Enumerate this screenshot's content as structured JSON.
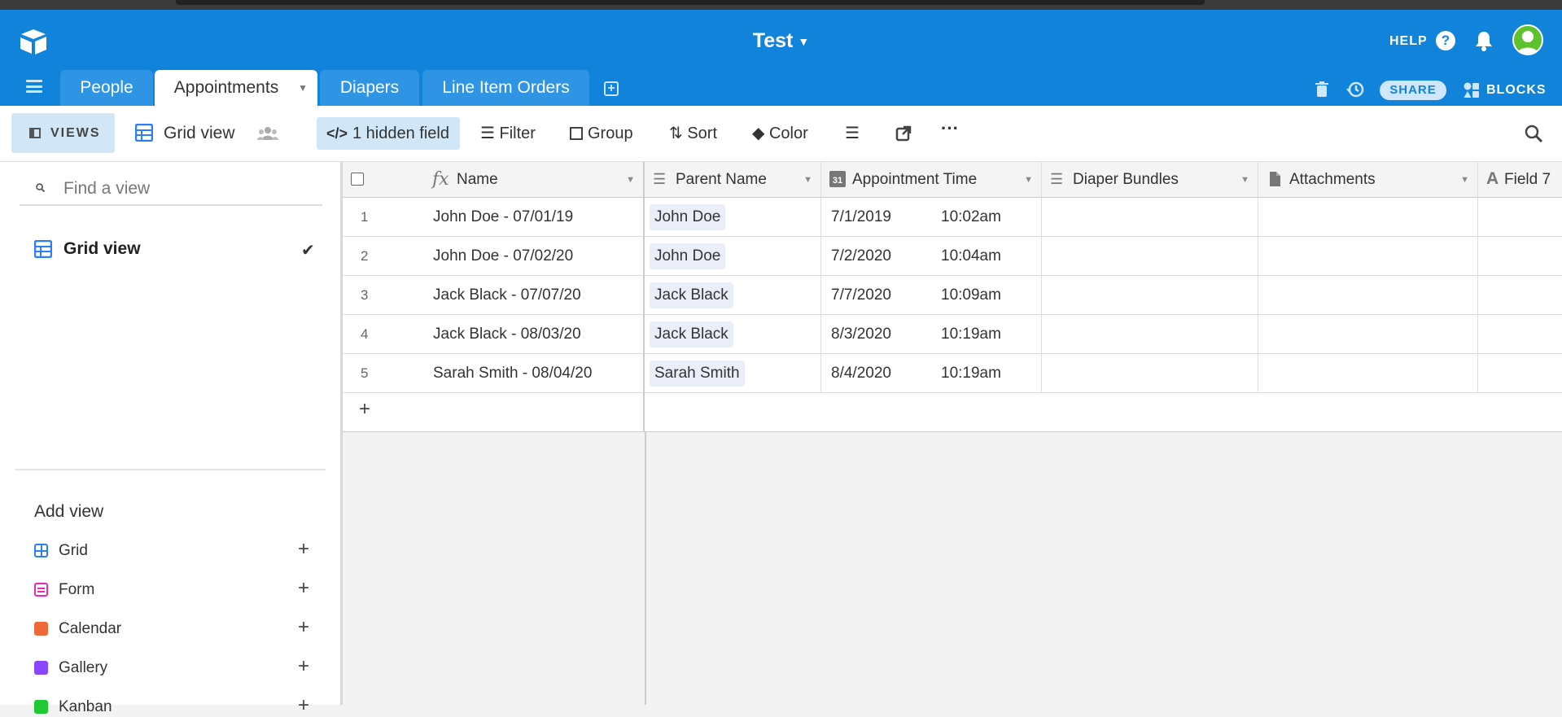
{
  "header": {
    "base_name": "Test",
    "help_label": "HELP",
    "share_label": "SHARE",
    "blocks_label": "BLOCKS"
  },
  "tabs": [
    {
      "label": "People"
    },
    {
      "label": "Appointments"
    },
    {
      "label": "Diapers"
    },
    {
      "label": "Line Item Orders"
    }
  ],
  "toolbar": {
    "views_label": "VIEWS",
    "current_view": "Grid view",
    "hidden_fields": "1 hidden field",
    "filter": "Filter",
    "group": "Group",
    "sort": "Sort",
    "color": "Color"
  },
  "sidebar": {
    "search_placeholder": "Find a view",
    "views": [
      {
        "label": "Grid view",
        "selected": true
      }
    ],
    "add_view_label": "Add view",
    "view_types": [
      {
        "label": "Grid",
        "color": "#2d7ff9"
      },
      {
        "label": "Form",
        "color": "#e929ba"
      },
      {
        "label": "Calendar",
        "color": "#f0693b"
      },
      {
        "label": "Gallery",
        "color": "#8b46ff"
      },
      {
        "label": "Kanban",
        "color": "#20c933"
      }
    ]
  },
  "grid": {
    "columns": [
      "Name",
      "Parent Name",
      "Appointment Time",
      "Diaper Bundles",
      "Attachments",
      "Field 7"
    ],
    "rows": [
      {
        "num": "1",
        "name": "John Doe - 07/01/19",
        "parent": "John Doe",
        "date": "7/1/2019",
        "time": "10:02am"
      },
      {
        "num": "2",
        "name": "John Doe - 07/02/20",
        "parent": "John Doe",
        "date": "7/2/2020",
        "time": "10:04am"
      },
      {
        "num": "3",
        "name": "Jack Black - 07/07/20",
        "parent": "Jack Black",
        "date": "7/7/2020",
        "time": "10:09am"
      },
      {
        "num": "4",
        "name": "Jack Black - 08/03/20",
        "parent": "Jack Black",
        "date": "8/3/2020",
        "time": "10:19am"
      },
      {
        "num": "5",
        "name": "Sarah Smith - 08/04/20",
        "parent": "Sarah Smith",
        "date": "8/4/2020",
        "time": "10:19am"
      }
    ],
    "add_row_label": "+"
  },
  "colors": {
    "header_blue": "#1283da",
    "tab_blue": "#2f94e3",
    "pill_bg": "#e9eef9"
  }
}
